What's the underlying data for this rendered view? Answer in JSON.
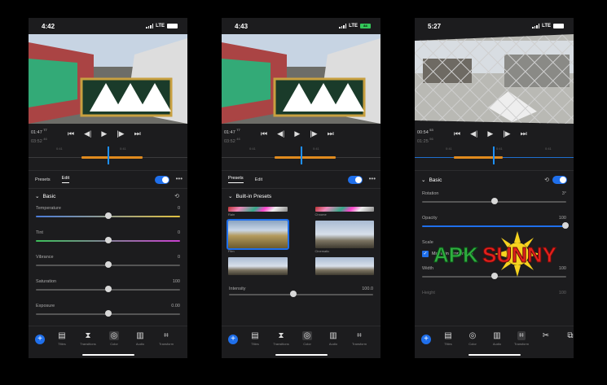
{
  "colors": {
    "accent": "#1f6feb",
    "orange": "#e08a1e",
    "bg": "#1c1c1e"
  },
  "phones": [
    {
      "status": {
        "time": "4:42",
        "network": "LTE",
        "battery": ""
      },
      "times": {
        "current": "01:47",
        "current_frames": "77",
        "total": "03:52",
        "total_frames": "46"
      },
      "timeline_ticks": [
        "0:41",
        "0:41"
      ],
      "tabs": [
        "Presets",
        "Edit"
      ],
      "section_title": "Basic",
      "sliders": [
        {
          "label": "Temperature",
          "value": "0",
          "position": 0.5
        },
        {
          "label": "Tint",
          "value": "0",
          "position": 0.5
        },
        {
          "label": "Vibrance",
          "value": "0",
          "position": 0.5
        },
        {
          "label": "Saturation",
          "value": "100",
          "position": 0.5
        },
        {
          "label": "Exposure",
          "value": "0.00",
          "position": 0.5
        }
      ],
      "tools": [
        "Titles",
        "Transitions",
        "Color",
        "Audio",
        "Transform"
      ]
    },
    {
      "status": {
        "time": "4:43",
        "network": "LTE",
        "battery": "84"
      },
      "times": {
        "current": "01:47",
        "current_frames": "77",
        "total": "03:52",
        "total_frames": "46"
      },
      "timeline_ticks": [
        "0:41",
        "0:41"
      ],
      "tabs": [
        "Presets",
        "Edit"
      ],
      "section_title": "Built-in Presets",
      "presets": [
        "Rain",
        "Chrome",
        "Film",
        "Cinematic",
        "",
        ""
      ],
      "intensity": {
        "label": "Intensity",
        "value": "100.0",
        "position": 0.45
      },
      "tools": [
        "Titles",
        "Transitions",
        "Color",
        "Audio",
        "Transform"
      ]
    },
    {
      "status": {
        "time": "5:27",
        "network": "LTE",
        "battery": ""
      },
      "times": {
        "current": "00:54",
        "current_frames": "53",
        "total": "01:25",
        "total_frames": "56"
      },
      "timeline_ticks": [
        "0:41",
        "0:41",
        "0:41"
      ],
      "section_title": "Basic",
      "rows": [
        {
          "label": "Rotation",
          "value": "3°",
          "position": 0.5
        },
        {
          "label": "Opacity",
          "value": "100",
          "position": 0.95
        },
        {
          "label": "Width",
          "value": "100",
          "position": 0.5
        },
        {
          "label": "Height",
          "value": "100",
          "position": 0.5
        }
      ],
      "scale_label": "Scale",
      "maintain_label": "Maintain Proportions",
      "tools": [
        "Titles",
        "Color",
        "Audio",
        "Transform"
      ]
    }
  ],
  "watermark": {
    "text": "ApkSunny"
  }
}
